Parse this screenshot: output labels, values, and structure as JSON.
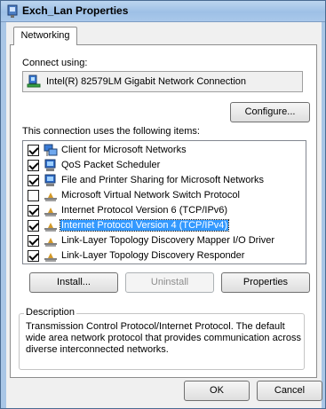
{
  "window": {
    "title": "Exch_Lan Properties"
  },
  "tabs": [
    {
      "label": "Networking",
      "selected": true
    }
  ],
  "connect_using": {
    "label": "Connect using:",
    "adapter_name": "Intel(R) 82579LM Gigabit Network Connection",
    "configure_label": "Configure..."
  },
  "items": {
    "label": "This connection uses the following items:",
    "list": [
      {
        "label": "Client for Microsoft Networks",
        "checked": true,
        "icon": "network-client-icon"
      },
      {
        "label": "QoS Packet Scheduler",
        "checked": true,
        "icon": "network-service-icon"
      },
      {
        "label": "File and Printer Sharing for Microsoft Networks",
        "checked": true,
        "icon": "network-service-icon"
      },
      {
        "label": "Microsoft Virtual Network Switch Protocol",
        "checked": false,
        "icon": "protocol-icon"
      },
      {
        "label": "Internet Protocol Version 6 (TCP/IPv6)",
        "checked": true,
        "icon": "protocol-icon"
      },
      {
        "label": "Internet Protocol Version 4 (TCP/IPv4)",
        "checked": true,
        "icon": "protocol-icon",
        "selected": true
      },
      {
        "label": "Link-Layer Topology Discovery Mapper I/O Driver",
        "checked": true,
        "icon": "protocol-icon"
      },
      {
        "label": "Link-Layer Topology Discovery Responder",
        "checked": true,
        "icon": "protocol-icon"
      }
    ]
  },
  "buttons": {
    "install": "Install...",
    "uninstall": "Uninstall",
    "properties": "Properties",
    "ok": "OK",
    "cancel": "Cancel"
  },
  "description": {
    "title": "Description",
    "text": "Transmission Control Protocol/Internet Protocol. The default wide area network protocol that provides communication across diverse interconnected networks."
  },
  "colors": {
    "selection": "#3399ff",
    "titlebar": "#9ec0e6"
  }
}
